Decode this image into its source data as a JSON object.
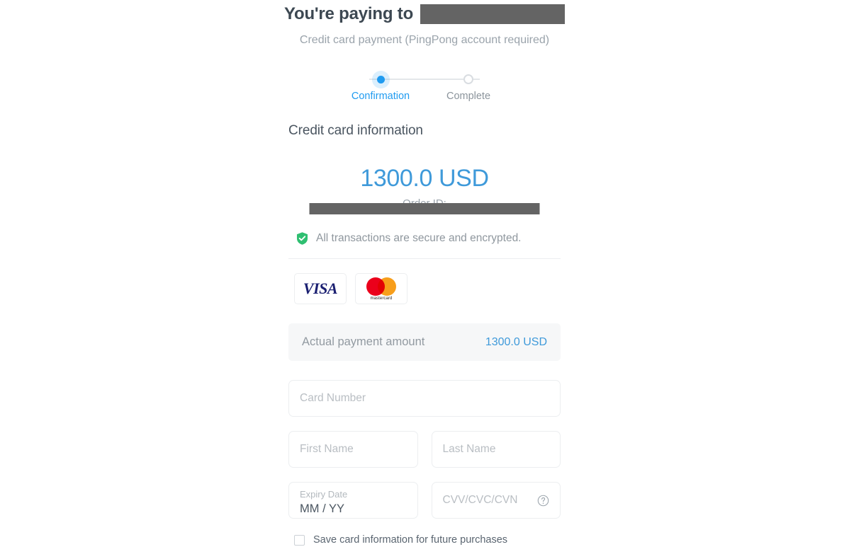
{
  "header": {
    "paying_to_label": "You're paying to",
    "merchant_redacted": true,
    "subtitle": "Credit card payment (PingPong account required)"
  },
  "stepper": {
    "steps": [
      {
        "label": "Confirmation",
        "state": "active"
      },
      {
        "label": "Complete",
        "state": "inactive"
      }
    ]
  },
  "section": {
    "title": "Credit card information"
  },
  "amount": {
    "value": "1300.0 USD",
    "order_id_label": "Order ID:",
    "order_id_redacted": true
  },
  "security": {
    "icon": "shield-check-icon",
    "text": "All transactions are secure and encrypted."
  },
  "brands": [
    {
      "name": "visa",
      "label": "VISA"
    },
    {
      "name": "mastercard",
      "label": "mastercard"
    }
  ],
  "payment_row": {
    "label": "Actual payment amount",
    "value": "1300.0 USD"
  },
  "form": {
    "card_number": {
      "placeholder": "Card Number",
      "value": ""
    },
    "first_name": {
      "placeholder": "First Name",
      "value": ""
    },
    "last_name": {
      "placeholder": "Last Name",
      "value": ""
    },
    "expiry": {
      "label": "Expiry Date",
      "value": "MM / YY"
    },
    "cvv": {
      "placeholder": "CVV/CVC/CVN",
      "value": "",
      "help_icon": "question-circle-icon"
    }
  },
  "save_card": {
    "label": "Save card information for future purchases",
    "checked": false
  },
  "colors": {
    "accent_blue": "#3f9ada",
    "step_active_blue": "#1f9bf0",
    "heading": "#4a5560",
    "muted": "#9aa3ab",
    "shield_green": "#2fbf71",
    "redaction": "#646464",
    "visa_navy": "#1a1f71",
    "mastercard_red": "#eb001b",
    "mastercard_orange": "#f79e1b"
  }
}
